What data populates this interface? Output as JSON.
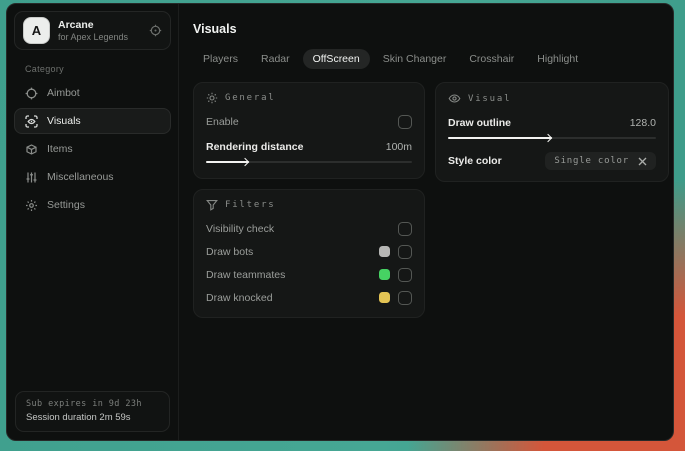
{
  "sidebar": {
    "brand": {
      "initial": "A",
      "name": "Arcane",
      "subtitle": "for Apex Legends"
    },
    "category_label": "Category",
    "items": [
      {
        "label": "Aimbot",
        "icon": "crosshair-icon",
        "selected": false
      },
      {
        "label": "Visuals",
        "icon": "scan-eye-icon",
        "selected": true
      },
      {
        "label": "Items",
        "icon": "package-icon",
        "selected": false
      },
      {
        "label": "Miscellaneous",
        "icon": "sliders-icon",
        "selected": false
      },
      {
        "label": "Settings",
        "icon": "gear-icon",
        "selected": false
      }
    ],
    "session": {
      "line1": "Sub expires in 9d 23h",
      "line2": "Session duration 2m 59s"
    }
  },
  "header": {
    "title": "Visuals"
  },
  "tabs": [
    {
      "label": "Players",
      "selected": false
    },
    {
      "label": "Radar",
      "selected": false
    },
    {
      "label": "OffScreen",
      "selected": true
    },
    {
      "label": "Skin Changer",
      "selected": false
    },
    {
      "label": "Crosshair",
      "selected": false
    },
    {
      "label": "Highlight",
      "selected": false
    }
  ],
  "panels": {
    "general": {
      "title": "General",
      "enable": {
        "label": "Enable",
        "checked": false
      },
      "rendering_distance": {
        "label": "Rendering distance",
        "value": "100m",
        "fill": "21%"
      }
    },
    "visual": {
      "title": "Visual",
      "draw_outline": {
        "label": "Draw outline",
        "value": "128.0",
        "fill": "50%"
      },
      "style_color": {
        "label": "Style color",
        "selected_option": "Single color"
      }
    },
    "filters": {
      "title": "Filters",
      "rows": [
        {
          "label": "Visibility check",
          "checked": false
        },
        {
          "label": "Draw bots",
          "swatch": "#b6b6b4",
          "checked": false
        },
        {
          "label": "Draw teammates",
          "swatch": "#46d263",
          "checked": false
        },
        {
          "label": "Draw knocked",
          "swatch": "#e3c454",
          "checked": false
        }
      ]
    }
  },
  "colors": {
    "window_bg": "#0e100f",
    "panel_bg": "#151716",
    "desktop_teal": "#46a794",
    "desktop_red": "#d4563a",
    "accent_text": "#eceeec"
  }
}
